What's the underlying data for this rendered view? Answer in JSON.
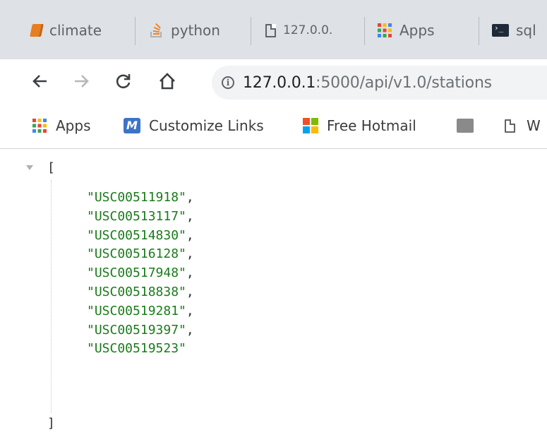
{
  "tabs": [
    {
      "label": "climate",
      "icon": "book-icon"
    },
    {
      "label": "python",
      "icon": "stackoverflow-icon"
    },
    {
      "label": "127.0.0.",
      "icon": "file-icon"
    },
    {
      "label": "Apps",
      "icon": "apps-grid-icon"
    },
    {
      "label": "sql",
      "icon": "terminal-icon"
    }
  ],
  "address_bar": {
    "host": "127.0.0.1",
    "path": ":5000/api/v1.0/stations"
  },
  "bookmarks": [
    {
      "label": "Apps",
      "icon": "apps-grid-icon"
    },
    {
      "label": "Customize Links",
      "icon": "m-logo-icon"
    },
    {
      "label": "Free Hotmail",
      "icon": "microsoft-logo-icon"
    },
    {
      "label": "",
      "icon": "image-icon"
    },
    {
      "label": "W",
      "icon": "file-icon"
    }
  ],
  "json_view": {
    "open_bracket": "[",
    "close_bracket": "]",
    "stations": [
      "\"USC00511918\"",
      "\"USC00513117\"",
      "\"USC00514830\"",
      "\"USC00516128\"",
      "\"USC00517948\"",
      "\"USC00518838\"",
      "\"USC00519281\"",
      "\"USC00519397\"",
      "\"USC00519523\""
    ],
    "comma": ","
  },
  "colors": {
    "tab_strip": "#dee1e6",
    "omnibox": "#f1f3f4",
    "json_string": "#1a7b1a"
  }
}
